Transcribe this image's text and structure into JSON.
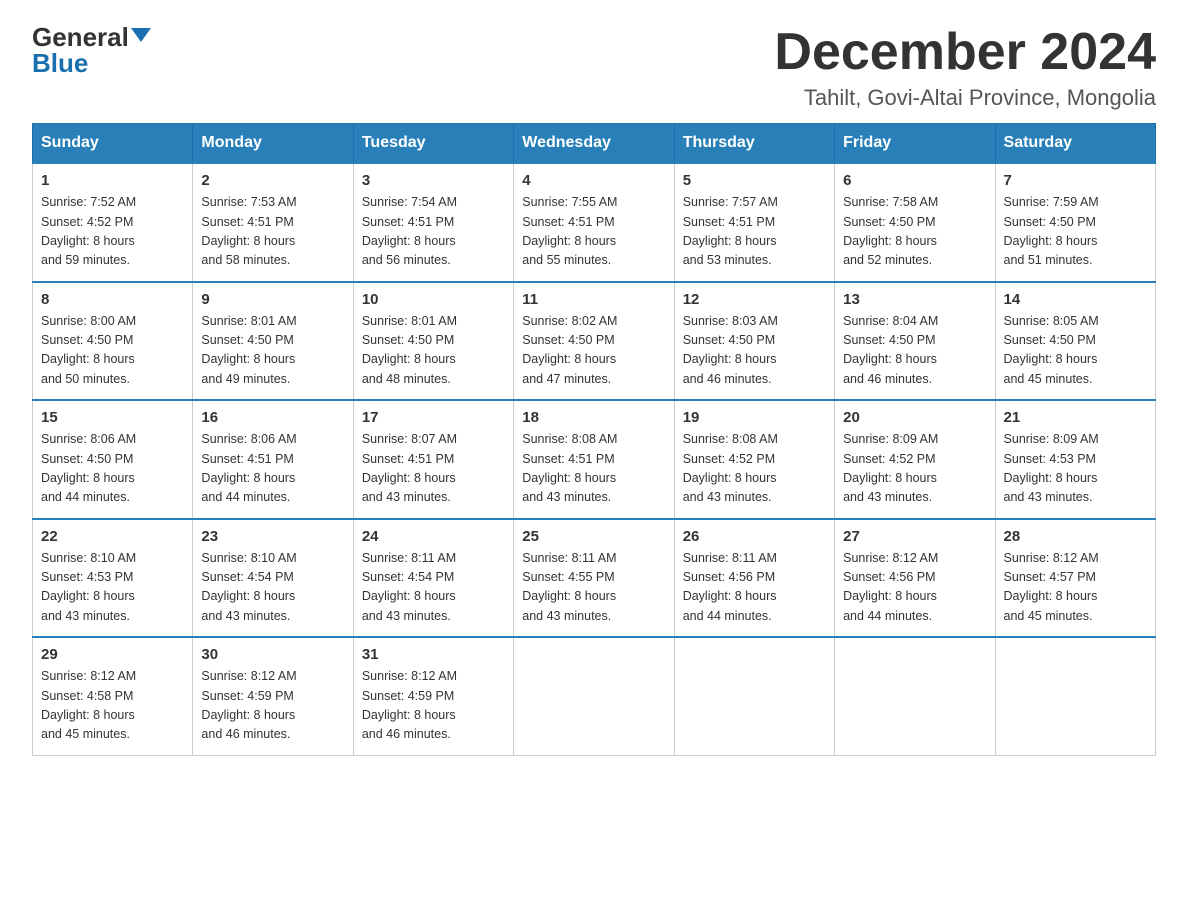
{
  "header": {
    "logo_general": "General",
    "logo_blue": "Blue",
    "month_title": "December 2024",
    "location": "Tahilt, Govi-Altai Province, Mongolia"
  },
  "weekdays": [
    "Sunday",
    "Monday",
    "Tuesday",
    "Wednesday",
    "Thursday",
    "Friday",
    "Saturday"
  ],
  "weeks": [
    [
      {
        "day": "1",
        "sunrise": "7:52 AM",
        "sunset": "4:52 PM",
        "daylight": "8 hours and 59 minutes."
      },
      {
        "day": "2",
        "sunrise": "7:53 AM",
        "sunset": "4:51 PM",
        "daylight": "8 hours and 58 minutes."
      },
      {
        "day": "3",
        "sunrise": "7:54 AM",
        "sunset": "4:51 PM",
        "daylight": "8 hours and 56 minutes."
      },
      {
        "day": "4",
        "sunrise": "7:55 AM",
        "sunset": "4:51 PM",
        "daylight": "8 hours and 55 minutes."
      },
      {
        "day": "5",
        "sunrise": "7:57 AM",
        "sunset": "4:51 PM",
        "daylight": "8 hours and 53 minutes."
      },
      {
        "day": "6",
        "sunrise": "7:58 AM",
        "sunset": "4:50 PM",
        "daylight": "8 hours and 52 minutes."
      },
      {
        "day": "7",
        "sunrise": "7:59 AM",
        "sunset": "4:50 PM",
        "daylight": "8 hours and 51 minutes."
      }
    ],
    [
      {
        "day": "8",
        "sunrise": "8:00 AM",
        "sunset": "4:50 PM",
        "daylight": "8 hours and 50 minutes."
      },
      {
        "day": "9",
        "sunrise": "8:01 AM",
        "sunset": "4:50 PM",
        "daylight": "8 hours and 49 minutes."
      },
      {
        "day": "10",
        "sunrise": "8:01 AM",
        "sunset": "4:50 PM",
        "daylight": "8 hours and 48 minutes."
      },
      {
        "day": "11",
        "sunrise": "8:02 AM",
        "sunset": "4:50 PM",
        "daylight": "8 hours and 47 minutes."
      },
      {
        "day": "12",
        "sunrise": "8:03 AM",
        "sunset": "4:50 PM",
        "daylight": "8 hours and 46 minutes."
      },
      {
        "day": "13",
        "sunrise": "8:04 AM",
        "sunset": "4:50 PM",
        "daylight": "8 hours and 46 minutes."
      },
      {
        "day": "14",
        "sunrise": "8:05 AM",
        "sunset": "4:50 PM",
        "daylight": "8 hours and 45 minutes."
      }
    ],
    [
      {
        "day": "15",
        "sunrise": "8:06 AM",
        "sunset": "4:50 PM",
        "daylight": "8 hours and 44 minutes."
      },
      {
        "day": "16",
        "sunrise": "8:06 AM",
        "sunset": "4:51 PM",
        "daylight": "8 hours and 44 minutes."
      },
      {
        "day": "17",
        "sunrise": "8:07 AM",
        "sunset": "4:51 PM",
        "daylight": "8 hours and 43 minutes."
      },
      {
        "day": "18",
        "sunrise": "8:08 AM",
        "sunset": "4:51 PM",
        "daylight": "8 hours and 43 minutes."
      },
      {
        "day": "19",
        "sunrise": "8:08 AM",
        "sunset": "4:52 PM",
        "daylight": "8 hours and 43 minutes."
      },
      {
        "day": "20",
        "sunrise": "8:09 AM",
        "sunset": "4:52 PM",
        "daylight": "8 hours and 43 minutes."
      },
      {
        "day": "21",
        "sunrise": "8:09 AM",
        "sunset": "4:53 PM",
        "daylight": "8 hours and 43 minutes."
      }
    ],
    [
      {
        "day": "22",
        "sunrise": "8:10 AM",
        "sunset": "4:53 PM",
        "daylight": "8 hours and 43 minutes."
      },
      {
        "day": "23",
        "sunrise": "8:10 AM",
        "sunset": "4:54 PM",
        "daylight": "8 hours and 43 minutes."
      },
      {
        "day": "24",
        "sunrise": "8:11 AM",
        "sunset": "4:54 PM",
        "daylight": "8 hours and 43 minutes."
      },
      {
        "day": "25",
        "sunrise": "8:11 AM",
        "sunset": "4:55 PM",
        "daylight": "8 hours and 43 minutes."
      },
      {
        "day": "26",
        "sunrise": "8:11 AM",
        "sunset": "4:56 PM",
        "daylight": "8 hours and 44 minutes."
      },
      {
        "day": "27",
        "sunrise": "8:12 AM",
        "sunset": "4:56 PM",
        "daylight": "8 hours and 44 minutes."
      },
      {
        "day": "28",
        "sunrise": "8:12 AM",
        "sunset": "4:57 PM",
        "daylight": "8 hours and 45 minutes."
      }
    ],
    [
      {
        "day": "29",
        "sunrise": "8:12 AM",
        "sunset": "4:58 PM",
        "daylight": "8 hours and 45 minutes."
      },
      {
        "day": "30",
        "sunrise": "8:12 AM",
        "sunset": "4:59 PM",
        "daylight": "8 hours and 46 minutes."
      },
      {
        "day": "31",
        "sunrise": "8:12 AM",
        "sunset": "4:59 PM",
        "daylight": "8 hours and 46 minutes."
      },
      null,
      null,
      null,
      null
    ]
  ],
  "labels": {
    "sunrise": "Sunrise:",
    "sunset": "Sunset:",
    "daylight": "Daylight:"
  }
}
